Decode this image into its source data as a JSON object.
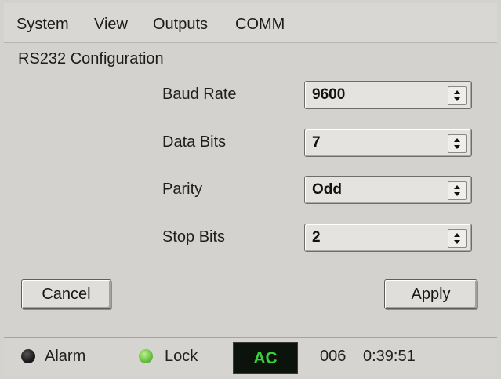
{
  "menu": {
    "items": [
      "System",
      "View",
      "Outputs",
      "COMM"
    ]
  },
  "group": {
    "title": "RS232 Configuration"
  },
  "fields": [
    {
      "label": "Baud Rate",
      "value": "9600"
    },
    {
      "label": "Data Bits",
      "value": "7"
    },
    {
      "label": "Parity",
      "value": "Odd"
    },
    {
      "label": "Stop Bits",
      "value": "2"
    }
  ],
  "buttons": {
    "cancel": "Cancel",
    "apply": "Apply"
  },
  "status": {
    "alarm_label": "Alarm",
    "alarm_color": "#1a1a1a",
    "lock_label": "Lock",
    "lock_color": "#5fb83a",
    "power_label": "AC",
    "power_color": "#39d13a",
    "counter": "006",
    "time": "0:39:51"
  }
}
